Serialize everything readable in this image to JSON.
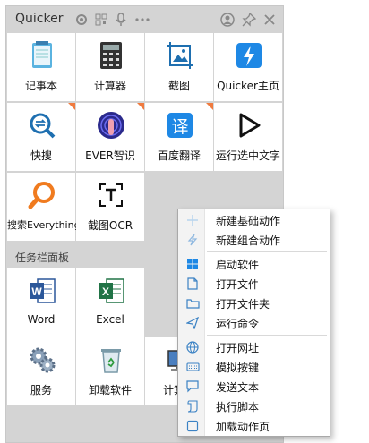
{
  "window": {
    "title": "Quicker"
  },
  "titlebar_icons": [
    "gear-icon",
    "qr-code-icon",
    "microphone-icon",
    "more-icon",
    "user-icon",
    "pin-icon",
    "close-icon"
  ],
  "actions": [
    {
      "label": "记事本",
      "icon": "notepad-icon"
    },
    {
      "label": "计算器",
      "icon": "calculator-icon"
    },
    {
      "label": "截图",
      "icon": "screenshot-icon"
    },
    {
      "label": "Quicker主页",
      "icon": "quicker-home-icon"
    },
    {
      "label": "快搜",
      "icon": "quick-search-icon"
    },
    {
      "label": "EVER智识",
      "icon": "ever-icon"
    },
    {
      "label": "百度翻译",
      "icon": "translate-icon"
    },
    {
      "label": "运行选中文字",
      "icon": "run-selection-icon"
    },
    {
      "label": "搜索Everything",
      "icon": "everything-search-icon"
    },
    {
      "label": "截图OCR",
      "icon": "ocr-icon"
    }
  ],
  "taskbar_panel": {
    "title": "任务栏面板",
    "items": [
      {
        "label": "Word",
        "icon": "word-icon"
      },
      {
        "label": "Excel",
        "icon": "excel-icon"
      },
      {
        "label": "服务",
        "icon": "services-icon"
      },
      {
        "label": "卸载软件",
        "icon": "uninstall-icon"
      },
      {
        "label": "计算机",
        "icon": "computer-icon"
      }
    ]
  },
  "context_menu": {
    "items": [
      {
        "label": "新建基础动作",
        "icon": "plus-icon"
      },
      {
        "label": "新建组合动作",
        "icon": "lightning-icon"
      },
      {
        "label": "启动软件",
        "icon": "windows-icon"
      },
      {
        "label": "打开文件",
        "icon": "file-icon"
      },
      {
        "label": "打开文件夹",
        "icon": "folder-icon"
      },
      {
        "label": "运行命令",
        "icon": "send-icon"
      },
      {
        "label": "打开网址",
        "icon": "globe-icon"
      },
      {
        "label": "模拟按键",
        "icon": "keyboard-icon"
      },
      {
        "label": "发送文本",
        "icon": "message-icon"
      },
      {
        "label": "执行脚本",
        "icon": "script-icon"
      },
      {
        "label": "加载动作页",
        "icon": "page-icon"
      }
    ]
  },
  "colors": {
    "accent_blue": "#1e88e5",
    "badge_orange": "#f07b3f",
    "panel_gray": "#d4d4d4"
  }
}
